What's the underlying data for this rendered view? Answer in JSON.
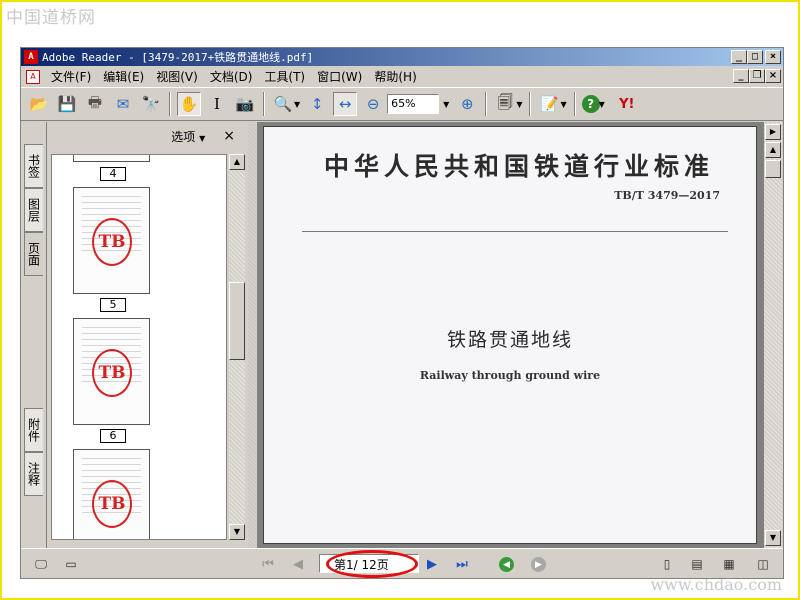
{
  "overlay": {
    "logo": "中国道桥网",
    "url": "www.chdao.com"
  },
  "window": {
    "title": "Adobe Reader - [3479-2017+铁路贯通地线.pdf]",
    "controls": [
      "minimize",
      "maximize",
      "close"
    ]
  },
  "menu": {
    "items": [
      "文件(F)",
      "编辑(E)",
      "视图(V)",
      "文档(D)",
      "工具(T)",
      "窗口(W)",
      "帮助(H)"
    ]
  },
  "toolbar": {
    "zoom_value": "65%",
    "icons": [
      "open-icon",
      "save-icon",
      "print-icon",
      "email-icon",
      "search-icon",
      "hand-tool-icon",
      "select-text-icon",
      "snapshot-icon",
      "zoom-in-icon",
      "fit-height-icon",
      "fit-width-icon",
      "zoom-out-minus-icon",
      "zoom-in-plus-icon",
      "pages-icon",
      "edit-icon",
      "help-icon",
      "yahoo-icon"
    ],
    "brand": "Y!"
  },
  "side_tabs": [
    "书签",
    "图层",
    "页面",
    "附件",
    "注释"
  ],
  "nav_panel": {
    "options_label": "选项",
    "close_label": "×",
    "thumbnails": [
      {
        "label": "4",
        "stamp": ""
      },
      {
        "label": "5",
        "stamp": "TB"
      },
      {
        "label": "6",
        "stamp": "TB"
      },
      {
        "label": "",
        "stamp": "TB"
      }
    ]
  },
  "document": {
    "header": "中华人民共和国铁道行业标准",
    "code": "TB/T 3479—2017",
    "title_cn": "铁路贯通地线",
    "title_en": "Railway through ground wire"
  },
  "statusbar": {
    "page_indicator": "第1/ 12页",
    "current_page": 1,
    "total_pages": 12
  },
  "colors": {
    "titlebar_start": "#0a246a",
    "titlebar_end": "#a6caf0",
    "highlight": "#e01010",
    "stamp": "#d42222",
    "frame": "#f2e200"
  }
}
